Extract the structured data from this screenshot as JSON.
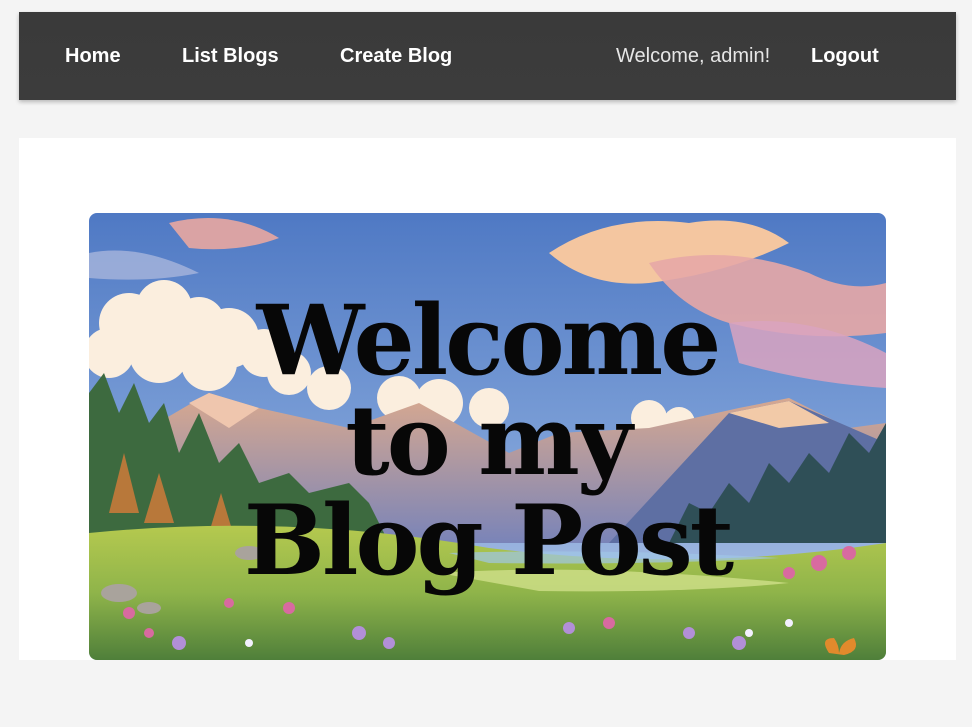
{
  "nav": {
    "home": "Home",
    "list_blogs": "List Blogs",
    "create_blog": "Create Blog",
    "welcome": "Welcome, admin!",
    "logout": "Logout"
  },
  "hero": {
    "line1": "Welcome",
    "line2": "to my",
    "line3": "Blog Post"
  },
  "colors": {
    "navbar": "#3a3a3a",
    "page_bg": "#f4f4f4",
    "card_bg": "#ffffff",
    "nav_text": "#ffffff"
  }
}
